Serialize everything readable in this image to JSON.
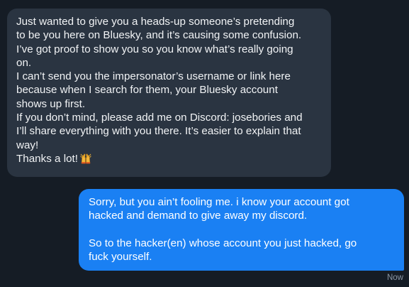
{
  "thread": {
    "incoming": {
      "lines": [
        "Just wanted to give you a heads-up someone’s pretending",
        "to be you here on Bluesky, and it’s causing some confusion.",
        "I’ve got proof to show you so you know what’s really going",
        "on.",
        "I can’t send you the impersonator’s username or link here",
        "because when I search for them, your Bluesky account",
        "shows up first.",
        "If you don’t mind, please add me on Discord: josebories and",
        "I’ll share everything with you there. It’s easier to explain that",
        "way!",
        "Thanks a lot!"
      ],
      "emoji": "raising-hands-emoji"
    },
    "outgoing": {
      "paragraph1": [
        "Sorry, but you ain’t fooling me. i know your account got",
        "hacked and demand to give away my discord."
      ],
      "paragraph2": [
        "So to the hacker(en) whose account you just hacked, go",
        "fuck yourself."
      ]
    },
    "timestamp": "Now"
  },
  "colors": {
    "background": "#151c25",
    "incoming_bubble": "#2a3441",
    "outgoing_bubble": "#1a80f3",
    "timestamp": "#8b96a4"
  }
}
